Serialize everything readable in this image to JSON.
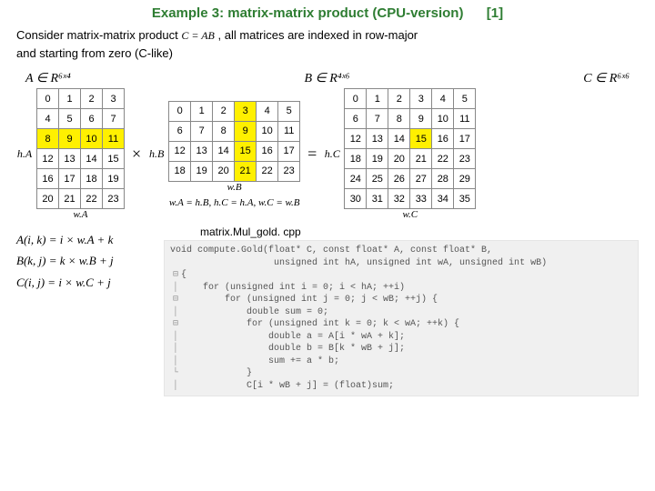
{
  "title": "Example 3: matrix-matrix product (CPU-version)",
  "ref": "[1]",
  "para": {
    "pre": "Consider matrix-matrix product ",
    "eq": "C = AB",
    "mid": " , all matrices are indexed in row-major",
    "line2": "and starting from zero (C-like)"
  },
  "sets": {
    "A": "A ∈ R⁶ˣ⁴",
    "B": "B ∈ R⁴ˣ⁶",
    "C": "C ∈ R⁶ˣ⁶"
  },
  "labels": {
    "hA": "h.A",
    "hB": "h.B",
    "hC": "h.C",
    "wA": "w.A",
    "wB": "w.B",
    "wC": "w.C"
  },
  "widthEq": "w.A = h.B,  h.C = h.A,  w.C = w.B",
  "ops": {
    "times": "×",
    "equals": "="
  },
  "matrixA": [
    [
      "0",
      "1",
      "2",
      "3"
    ],
    [
      "4",
      "5",
      "6",
      "7"
    ],
    [
      "8",
      "9",
      "10",
      "11"
    ],
    [
      "12",
      "13",
      "14",
      "15"
    ],
    [
      "16",
      "17",
      "18",
      "19"
    ],
    [
      "20",
      "21",
      "22",
      "23"
    ]
  ],
  "matrixB": [
    [
      "0",
      "1",
      "2",
      "3",
      "4",
      "5"
    ],
    [
      "6",
      "7",
      "8",
      "9",
      "10",
      "11"
    ],
    [
      "12",
      "13",
      "14",
      "15",
      "16",
      "17"
    ],
    [
      "18",
      "19",
      "20",
      "21",
      "22",
      "23"
    ]
  ],
  "matrixC": [
    [
      "0",
      "1",
      "2",
      "3",
      "4",
      "5"
    ],
    [
      "6",
      "7",
      "8",
      "9",
      "10",
      "11"
    ],
    [
      "12",
      "13",
      "14",
      "15",
      "16",
      "17"
    ],
    [
      "18",
      "19",
      "20",
      "21",
      "22",
      "23"
    ],
    [
      "24",
      "25",
      "26",
      "27",
      "28",
      "29"
    ],
    [
      "30",
      "31",
      "32",
      "33",
      "34",
      "35"
    ]
  ],
  "indexEq": {
    "A": "A(i, k) = i × w.A + k",
    "B": "B(k, j) = k × w.B + j",
    "C": "C(i, j) = i × w.C + j"
  },
  "codeCaption": "matrix.Mul_gold. cpp",
  "code": {
    "sig1": "void compute.Gold(float* C, const float* A, const float* B,",
    "sig2": "                   unsigned int hA, unsigned int wA, unsigned int wB)",
    "l1": "{",
    "l2": "    for (unsigned int i = 0; i < hA; ++i)",
    "l3": "        for (unsigned int j = 0; j < wB; ++j) {",
    "l4": "            double sum = 0;",
    "l5": "            for (unsigned int k = 0; k < wA; ++k) {",
    "l6": "                double a = A[i * wA + k];",
    "l7": "                double b = B[k * wB + j];",
    "l8": "                sum += a * b;",
    "l9": "            }",
    "l10": "            C[i * wB + j] = (float)sum;"
  }
}
